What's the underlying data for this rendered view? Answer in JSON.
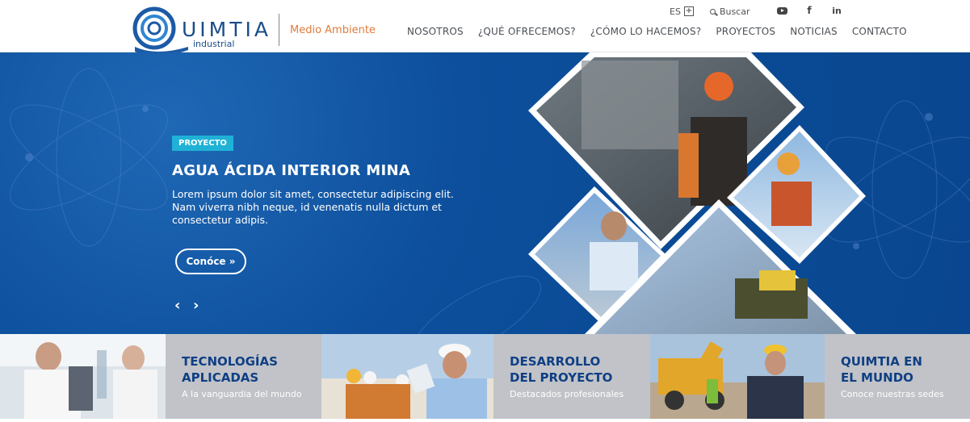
{
  "header": {
    "logo_word": "UIMTIA",
    "logo_sub": "industrial",
    "tagline": "Medio Ambiente",
    "lang": "ES",
    "lang_toggle": "+",
    "search_placeholder": "Buscar",
    "socials": [
      "youtube-icon",
      "facebook-icon",
      "linkedin-icon"
    ],
    "facebook_glyph": "f",
    "linkedin_glyph": "in",
    "nav": [
      "NOSOTROS",
      "¿QUÉ OFRECEMOS?",
      "¿CÓMO LO HACEMOS?",
      "PROYECTOS",
      "NOTICIAS",
      "CONTACTO"
    ]
  },
  "hero": {
    "badge": "PROYECTO",
    "title": "AGUA ÁCIDA INTERIOR MINA",
    "text": "Lorem ipsum dolor sit amet, consectetur adipiscing elit. Nam viverra nibh neque, id venenatis nulla dictum et consectetur adipis.",
    "cta": "Conóce »",
    "prev": "‹",
    "next": "›"
  },
  "features": [
    {
      "title": "TECNOLOGÍAS\nAPLICADAS",
      "title_line1": "TECNOLOGÍAS",
      "title_line2": "APLICADAS",
      "subtitle": "A la vanguardia del mundo"
    },
    {
      "title": "DESARROLLO\nDEL PROYECTO",
      "title_line1": "DESARROLLO",
      "title_line2": "DEL PROYECTO",
      "subtitle": "Destacados profesionales"
    },
    {
      "title": "QUIMTIA EN\nEL MUNDO",
      "title_line1": "QUIMTIA EN",
      "title_line2": "EL MUNDO",
      "subtitle": "Conoce nuestras sedes"
    }
  ],
  "colors": {
    "brand_blue": "#0a4a94",
    "accent_orange": "#e07b3c",
    "badge_cyan": "#1fb2d6",
    "feature_panel": "#c1c3c8"
  }
}
